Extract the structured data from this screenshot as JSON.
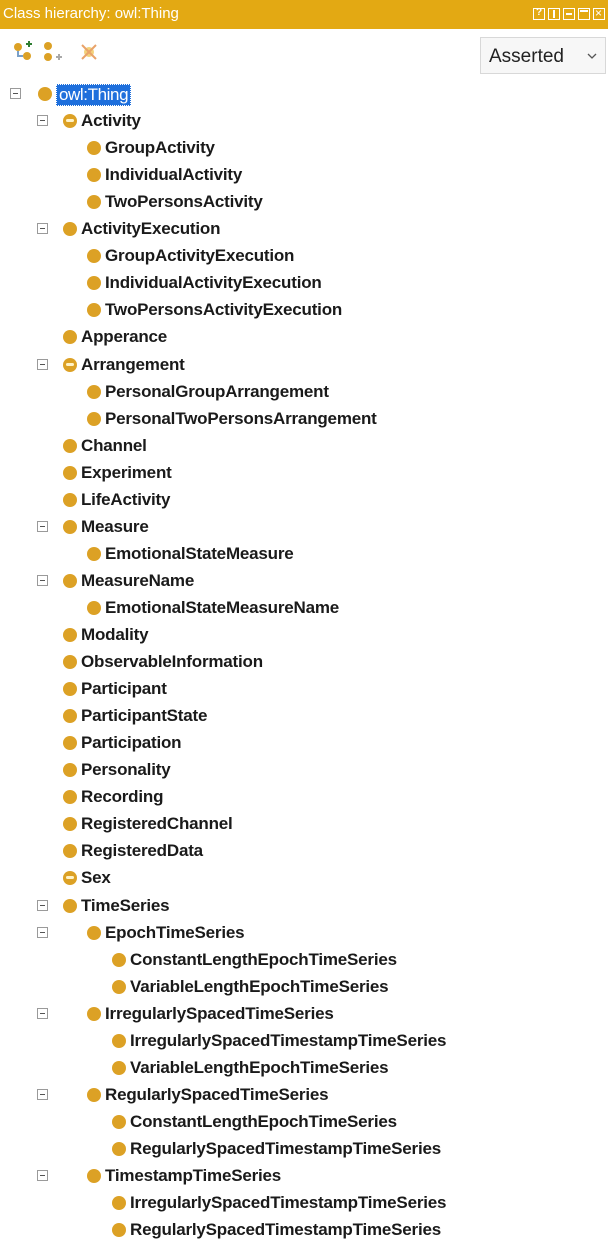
{
  "window": {
    "title": "Class hierarchy: owl:Thing",
    "controls": [
      "help-icon",
      "split-icon",
      "minimize-icon",
      "maximize-icon",
      "close-icon"
    ]
  },
  "toolbar": {
    "icons": [
      "add-subclass-icon",
      "add-sibling-icon",
      "delete-class-icon"
    ],
    "mode": "Asserted"
  },
  "colors": {
    "title_bar": "#e3a913",
    "class_bullet": "#dca125",
    "selection": "#1e6fdc"
  },
  "tree": [
    {
      "label": "owl:Thing",
      "level": 0,
      "expandable": true,
      "selected": true,
      "icon": "class-bullet-icon"
    },
    {
      "label": "Activity",
      "level": 1,
      "expandable": true,
      "icon": "defined-class-icon"
    },
    {
      "label": "GroupActivity",
      "level": 2,
      "expandable": false,
      "icon": "class-bullet-icon"
    },
    {
      "label": "IndividualActivity",
      "level": 2,
      "expandable": false,
      "icon": "class-bullet-icon"
    },
    {
      "label": "TwoPersonsActivity",
      "level": 2,
      "expandable": false,
      "icon": "class-bullet-icon"
    },
    {
      "label": "ActivityExecution",
      "level": 1,
      "expandable": true,
      "icon": "class-bullet-icon"
    },
    {
      "label": "GroupActivityExecution",
      "level": 2,
      "expandable": false,
      "icon": "class-bullet-icon"
    },
    {
      "label": "IndividualActivityExecution",
      "level": 2,
      "expandable": false,
      "icon": "class-bullet-icon"
    },
    {
      "label": "TwoPersonsActivityExecution",
      "level": 2,
      "expandable": false,
      "icon": "class-bullet-icon"
    },
    {
      "label": "Apperance",
      "level": 1,
      "expandable": false,
      "icon": "class-bullet-icon"
    },
    {
      "label": "Arrangement",
      "level": 1,
      "expandable": true,
      "icon": "defined-class-icon"
    },
    {
      "label": "PersonalGroupArrangement",
      "level": 2,
      "expandable": false,
      "icon": "class-bullet-icon"
    },
    {
      "label": "PersonalTwoPersonsArrangement",
      "level": 2,
      "expandable": false,
      "icon": "class-bullet-icon"
    },
    {
      "label": "Channel",
      "level": 1,
      "expandable": false,
      "icon": "class-bullet-icon"
    },
    {
      "label": "Experiment",
      "level": 1,
      "expandable": false,
      "icon": "class-bullet-icon"
    },
    {
      "label": "LifeActivity",
      "level": 1,
      "expandable": false,
      "icon": "class-bullet-icon"
    },
    {
      "label": "Measure",
      "level": 1,
      "expandable": true,
      "icon": "class-bullet-icon"
    },
    {
      "label": "EmotionalStateMeasure",
      "level": 2,
      "expandable": false,
      "icon": "class-bullet-icon"
    },
    {
      "label": "MeasureName",
      "level": 1,
      "expandable": true,
      "icon": "class-bullet-icon"
    },
    {
      "label": "EmotionalStateMeasureName",
      "level": 2,
      "expandable": false,
      "icon": "class-bullet-icon"
    },
    {
      "label": "Modality",
      "level": 1,
      "expandable": false,
      "icon": "class-bullet-icon"
    },
    {
      "label": "ObservableInformation",
      "level": 1,
      "expandable": false,
      "icon": "class-bullet-icon"
    },
    {
      "label": "Participant",
      "level": 1,
      "expandable": false,
      "icon": "class-bullet-icon"
    },
    {
      "label": "ParticipantState",
      "level": 1,
      "expandable": false,
      "icon": "class-bullet-icon"
    },
    {
      "label": "Participation",
      "level": 1,
      "expandable": false,
      "icon": "class-bullet-icon"
    },
    {
      "label": "Personality",
      "level": 1,
      "expandable": false,
      "icon": "class-bullet-icon"
    },
    {
      "label": "Recording",
      "level": 1,
      "expandable": false,
      "icon": "class-bullet-icon"
    },
    {
      "label": "RegisteredChannel",
      "level": 1,
      "expandable": false,
      "icon": "class-bullet-icon"
    },
    {
      "label": "RegisteredData",
      "level": 1,
      "expandable": false,
      "icon": "class-bullet-icon"
    },
    {
      "label": "Sex",
      "level": 1,
      "expandable": false,
      "icon": "defined-class-icon"
    },
    {
      "label": "TimeSeries",
      "level": 1,
      "expandable": true,
      "icon": "class-bullet-icon"
    },
    {
      "label": "EpochTimeSeries",
      "level": 2,
      "expandable": true,
      "icon": "class-bullet-icon"
    },
    {
      "label": "ConstantLengthEpochTimeSeries",
      "level": 3,
      "expandable": false,
      "icon": "class-bullet-icon"
    },
    {
      "label": "VariableLengthEpochTimeSeries",
      "level": 3,
      "expandable": false,
      "icon": "class-bullet-icon"
    },
    {
      "label": "IrregularlySpacedTimeSeries",
      "level": 2,
      "expandable": true,
      "icon": "class-bullet-icon"
    },
    {
      "label": "IrregularlySpacedTimestampTimeSeries",
      "level": 3,
      "expandable": false,
      "icon": "class-bullet-icon"
    },
    {
      "label": "VariableLengthEpochTimeSeries",
      "level": 3,
      "expandable": false,
      "icon": "class-bullet-icon"
    },
    {
      "label": "RegularlySpacedTimeSeries",
      "level": 2,
      "expandable": true,
      "icon": "class-bullet-icon"
    },
    {
      "label": "ConstantLengthEpochTimeSeries",
      "level": 3,
      "expandable": false,
      "icon": "class-bullet-icon"
    },
    {
      "label": "RegularlySpacedTimestampTimeSeries",
      "level": 3,
      "expandable": false,
      "icon": "class-bullet-icon"
    },
    {
      "label": "TimestampTimeSeries",
      "level": 2,
      "expandable": true,
      "icon": "class-bullet-icon"
    },
    {
      "label": "IrregularlySpacedTimestampTimeSeries",
      "level": 3,
      "expandable": false,
      "icon": "class-bullet-icon"
    },
    {
      "label": "RegularlySpacedTimestampTimeSeries",
      "level": 3,
      "expandable": false,
      "icon": "class-bullet-icon"
    }
  ]
}
